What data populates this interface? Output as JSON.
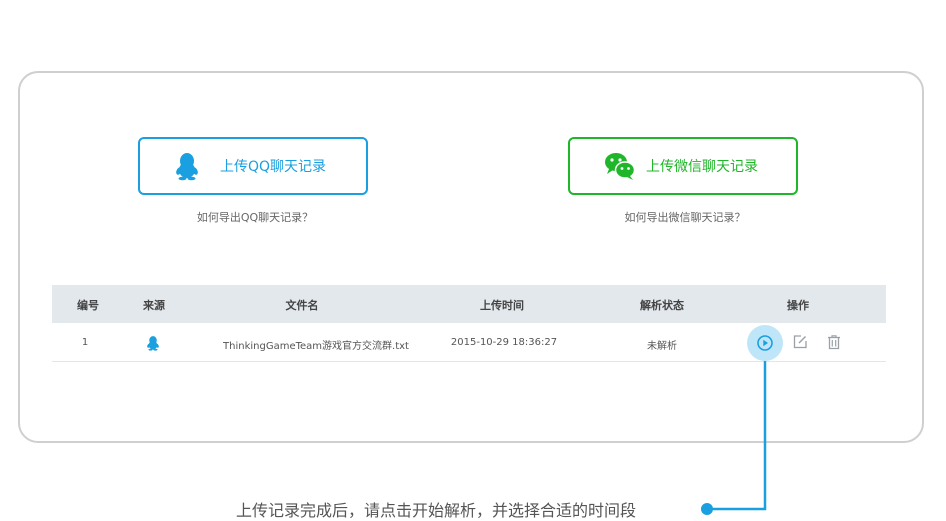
{
  "upload": {
    "qq_label": "上传QQ聊天记录",
    "wechat_label": "上传微信聊天记录",
    "qq_help": "如何导出QQ聊天记录？",
    "wechat_help": "如何导出微信聊天记录？"
  },
  "table": {
    "headers": [
      "编号",
      "来源",
      "文件名",
      "上传时间",
      "解析状态",
      "操作"
    ],
    "rows": [
      {
        "id": "1",
        "source_icon": "qq-penguin-icon",
        "filename": "ThinkingGameTeam游戏官方交流群.txt",
        "upload_time": "2015-10-29 18:36:27",
        "status": "未解析",
        "actions": [
          "play-icon",
          "edit-icon",
          "trash-icon"
        ]
      }
    ]
  },
  "hint": {
    "text": "上传记录完成后，请点击开始解析，并选择合适的时间段"
  },
  "colors": {
    "qq_blue": "#1a9fe0",
    "wechat_green": "#20b62a",
    "header_bg": "#e3e8ed",
    "play_bg": "#bfe6f8"
  }
}
